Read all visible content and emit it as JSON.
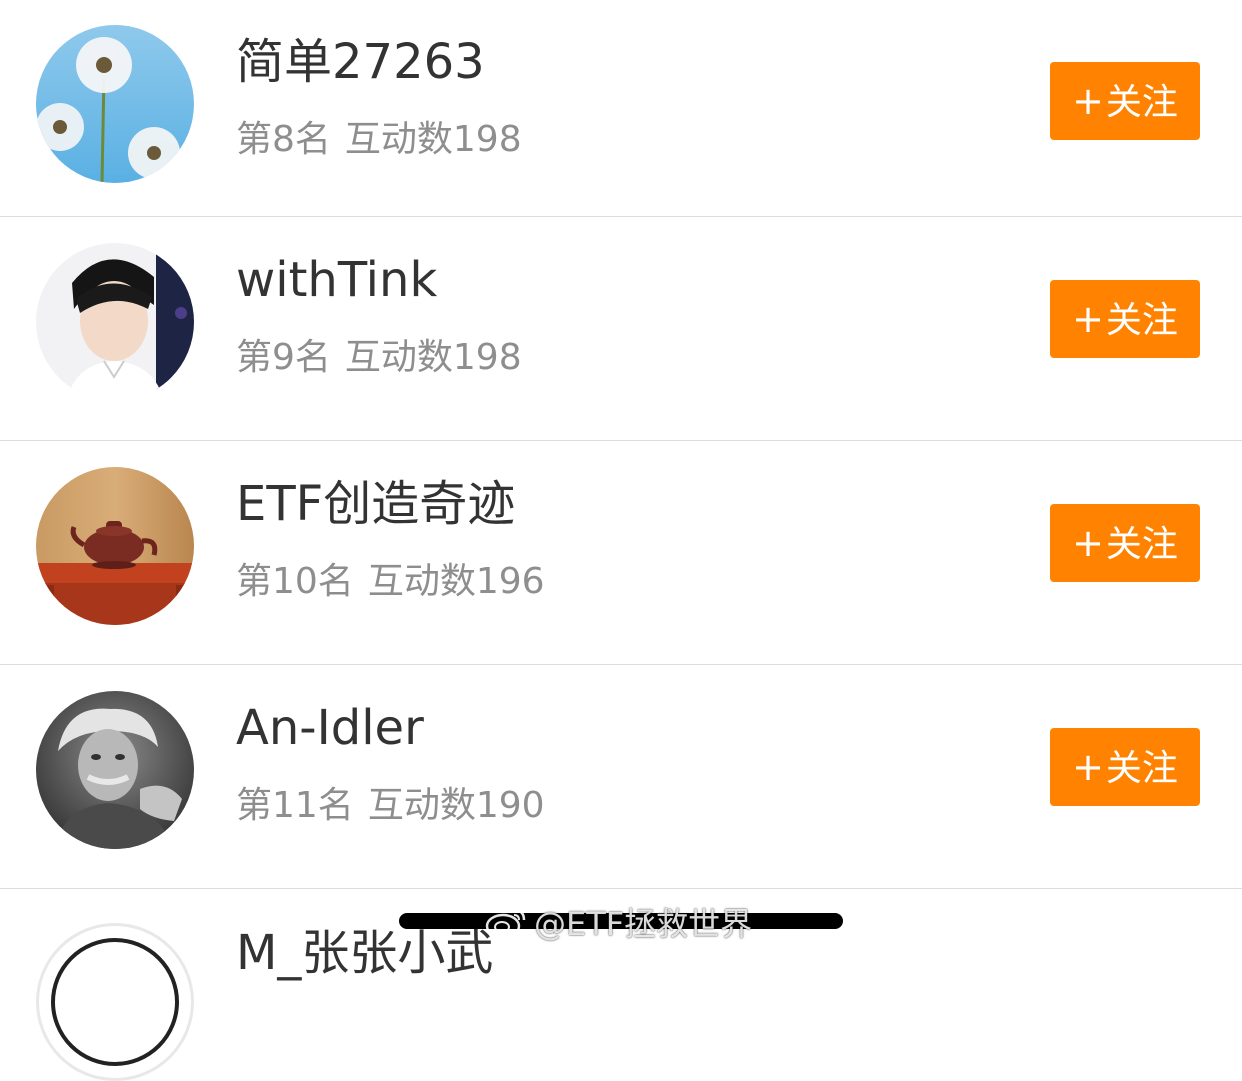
{
  "users": [
    {
      "name": "简单27263",
      "rank": "第8名",
      "interactions": "互动数198",
      "follow": "关注",
      "plus": "+"
    },
    {
      "name": "withTink",
      "rank": "第9名",
      "interactions": "互动数198",
      "follow": "关注",
      "plus": "+"
    },
    {
      "name": "ETF创造奇迹",
      "rank": "第10名",
      "interactions": "互动数196",
      "follow": "关注",
      "plus": "+"
    },
    {
      "name": "An-Idler",
      "rank": "第11名",
      "interactions": "互动数190",
      "follow": "关注",
      "plus": "+"
    }
  ],
  "partial_user": {
    "name": "M_张张小武"
  },
  "watermark": {
    "text": "@ETF拯救世界",
    "icon": "weibo-logo-icon"
  },
  "colors": {
    "accent": "#ff8200",
    "name": "#333333",
    "meta": "#8e8e8e",
    "divider": "#dcdcdc"
  },
  "avatar_icons": [
    "dandelion-photo-avatar",
    "young-man-photo-avatar",
    "teapot-photo-avatar",
    "einstein-photo-avatar",
    "ring-logo-avatar"
  ]
}
